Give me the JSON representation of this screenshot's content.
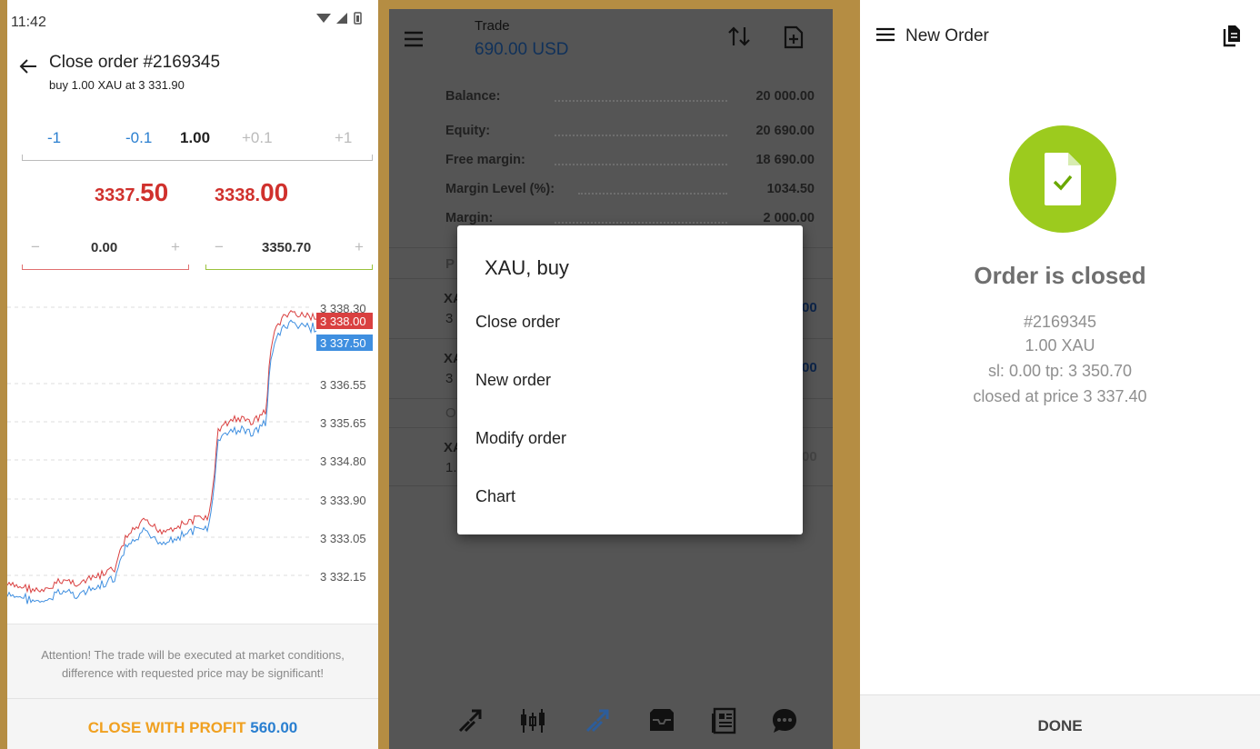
{
  "close_order": {
    "status_time": "11:42",
    "title": "Close order #2169345",
    "subtitle": "buy 1.00 XAU at 3 331.90",
    "volume": {
      "minus1": "-1",
      "minus01": "-0.1",
      "value": "1.00",
      "plus01": "+0.1",
      "plus1": "+1"
    },
    "bid": {
      "main": "3337.",
      "big": "50"
    },
    "ask": {
      "main": "3338.",
      "big": "00"
    },
    "stop_loss": {
      "minus": "−",
      "value": "0.00",
      "plus": "+"
    },
    "take_profit": {
      "minus": "−",
      "value": "3350.70",
      "plus": "+"
    },
    "price_labels": [
      "3 338.30",
      "3 336.55",
      "3 335.65",
      "3 334.80",
      "3 333.90",
      "3 333.05",
      "3 332.15"
    ],
    "ask_badge": "3 338.00",
    "bid_badge": "3 337.50",
    "attention": "Attention! The trade will be executed at market conditions, difference with requested price may be significant!",
    "close_button": {
      "label": "CLOSE WITH PROFIT",
      "amount": "560.00"
    },
    "colors": {
      "ask": "#d94040",
      "bid": "#3f8fe0",
      "sell_price": "#d0312d"
    }
  },
  "trade": {
    "label": "Trade",
    "amount": "690.00 USD",
    "account": [
      {
        "key": "Balance:",
        "value": "20 000.00"
      },
      {
        "key": "Equity:",
        "value": "20 690.00"
      },
      {
        "key": "Free margin:",
        "value": "18 690.00"
      },
      {
        "key": "Margin Level (%):",
        "value": "1034.50"
      },
      {
        "key": "Margin:",
        "value": "2 000.00"
      }
    ],
    "bleed": {
      "p": "P",
      "xa1": "XA",
      "n1": "3",
      "v1": "00",
      "xa2": "XA",
      "n2": "3",
      "v2": "00",
      "o": "O",
      "xa3": "XA",
      "n3": "1.",
      "v3": "00"
    },
    "dialog": {
      "title": "XAU, buy",
      "items": [
        "Close order",
        "New order",
        "Modify order",
        "Chart"
      ]
    },
    "bottom_icons": [
      "trade-arrows-icon",
      "candlestick-icon",
      "positions-icon",
      "inbox-icon",
      "news-icon",
      "chat-icon"
    ]
  },
  "new_order": {
    "title": "New Order",
    "status": "Order is closed",
    "ticket": "#2169345",
    "volume": "1.00 XAU",
    "sltp": "sl: 0.00 tp: 3 350.70",
    "closed_at": "closed at price 3 337.40",
    "done": "DONE",
    "success_color": "#9ccb1e"
  }
}
